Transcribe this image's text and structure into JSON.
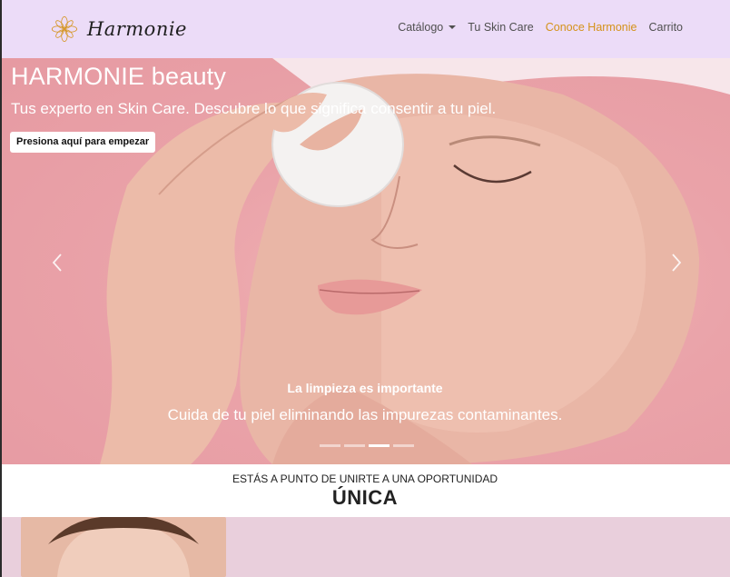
{
  "brand": {
    "name": "Harmonie",
    "logo_icon": "flower-logo-icon",
    "accent": "#d4921a"
  },
  "nav": {
    "items": [
      {
        "label": "Catálogo",
        "dropdown": true,
        "active": false
      },
      {
        "label": "Tu Skin Care",
        "dropdown": false,
        "active": false
      },
      {
        "label": "Conoce Harmonie",
        "dropdown": false,
        "active": true
      },
      {
        "label": "Carrito",
        "dropdown": false,
        "active": false
      }
    ]
  },
  "hero": {
    "title": "HARMONIE beauty",
    "subtitle": "Tus experto en Skin Care. Descubre lo que significa consentir a tu piel.",
    "cta_label": "Presiona aquí para empezar",
    "prev_icon": "chevron-left-icon",
    "next_icon": "chevron-right-icon",
    "caption_title": "La limpieza es importante",
    "caption_text": "Cuida de tu piel eliminando las impurezas contaminantes.",
    "slide_count": 4,
    "active_slide": 3
  },
  "section": {
    "kicker": "ESTÁS A PUNTO DE UNIRTE A UNA OPORTUNIDAD",
    "headline": "ÚNICA"
  },
  "colors": {
    "navbar_bg": "#ecdcf8",
    "band_bg": "#e9cfdc",
    "hero_bg": "#eaa3a9"
  }
}
